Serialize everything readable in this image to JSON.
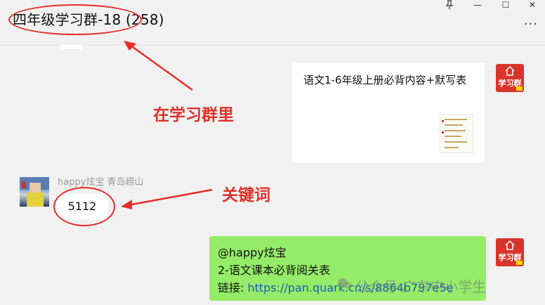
{
  "window": {
    "title": "四年级学习群-18 (258)",
    "pin_icon": "pin-icon",
    "minimize_label": "—",
    "maximize_label": "☐",
    "close_label": "✕",
    "more_label": "···"
  },
  "annotations": {
    "group_label": "在学习群里",
    "keyword_label": "关键词",
    "color": "#e52d27"
  },
  "messages": [
    {
      "id": "doc-message",
      "text": "语文1-6年级上册必背内容+默写表",
      "app_label": "学习群"
    },
    {
      "id": "keyword-message",
      "sender": "happy炫宝 青岛崂山",
      "text": "5112"
    },
    {
      "id": "reply-message",
      "lines": [
        "@happy炫宝",
        "2-语文课本必背阅关表"
      ],
      "link_prefix": "链接: ",
      "link": "https://pan.quark.cn/s/8864b797e5e",
      "app_label": "学习群"
    }
  ],
  "watermark": "公众号·广东中小学生",
  "colors": {
    "own_bubble": "#95ec69",
    "other_bubble": "#ffffff",
    "background": "#f1f1f1",
    "app_icon": "#d9342b"
  }
}
